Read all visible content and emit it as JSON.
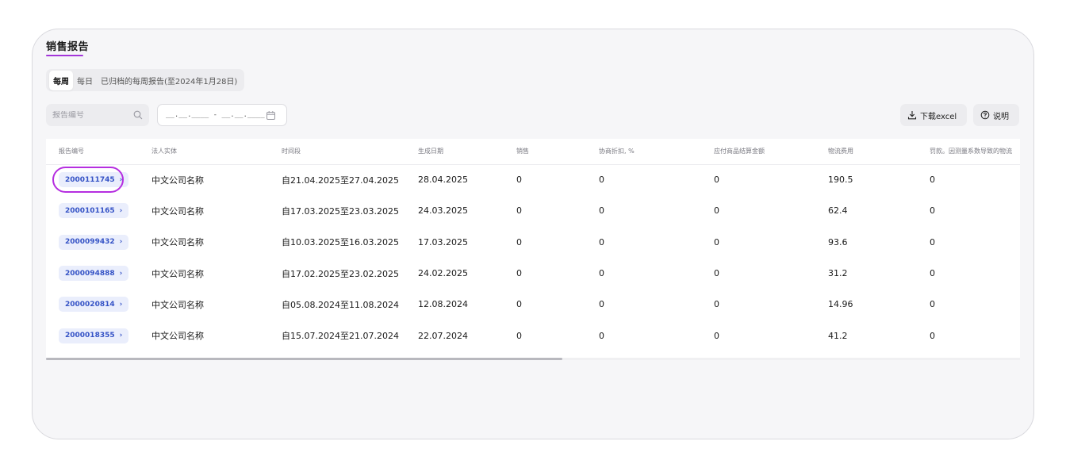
{
  "page": {
    "title": "销售报告",
    "tabs": [
      {
        "label": "每周",
        "active": true
      },
      {
        "label": "每日",
        "active": false
      },
      {
        "label": "已归档的每周报告(至2024年1月28日)",
        "active": false
      }
    ]
  },
  "filters": {
    "search_placeholder": "报告编号",
    "date_placeholder": "__.__.____ - __.__.____"
  },
  "actions": {
    "download_label": "下载excel",
    "help_label": "说明"
  },
  "table": {
    "columns": [
      "报告编号",
      "法人实体",
      "时间段",
      "生成日期",
      "销售",
      "协商折扣, %",
      "应付商品结算金额",
      "物流费用",
      "罚款。因测量系数导致的物流"
    ],
    "rows": [
      {
        "report": "2000111745",
        "entity": "中文公司名称",
        "period": "自21.04.2025至27.04.2025",
        "created": "28.04.2025",
        "sales": "0",
        "discount": "0",
        "payable": "0",
        "logistics": "190.5",
        "fines": "0"
      },
      {
        "report": "2000101165",
        "entity": "中文公司名称",
        "period": "自17.03.2025至23.03.2025",
        "created": "24.03.2025",
        "sales": "0",
        "discount": "0",
        "payable": "0",
        "logistics": "62.4",
        "fines": "0"
      },
      {
        "report": "2000099432",
        "entity": "中文公司名称",
        "period": "自10.03.2025至16.03.2025",
        "created": "17.03.2025",
        "sales": "0",
        "discount": "0",
        "payable": "0",
        "logistics": "93.6",
        "fines": "0"
      },
      {
        "report": "2000094888",
        "entity": "中文公司名称",
        "period": "自17.02.2025至23.02.2025",
        "created": "24.02.2025",
        "sales": "0",
        "discount": "0",
        "payable": "0",
        "logistics": "31.2",
        "fines": "0"
      },
      {
        "report": "2000020814",
        "entity": "中文公司名称",
        "period": "自05.08.2024至11.08.2024",
        "created": "12.08.2024",
        "sales": "0",
        "discount": "0",
        "payable": "0",
        "logistics": "14.96",
        "fines": "0"
      },
      {
        "report": "2000018355",
        "entity": "中文公司名称",
        "period": "自15.07.2024至21.07.2024",
        "created": "22.07.2024",
        "sales": "0",
        "discount": "0",
        "payable": "0",
        "logistics": "41.2",
        "fines": "0"
      }
    ],
    "highlighted_row": 0,
    "chevron": "›"
  },
  "colors": {
    "accent": "#a335d9",
    "badge_bg": "#eaeefc",
    "badge_text": "#3553c6",
    "highlight_ring": "#b52ee0"
  },
  "icons": {
    "search": "search-icon",
    "calendar": "calendar-icon",
    "download": "download-icon",
    "help": "help-circle-icon"
  }
}
